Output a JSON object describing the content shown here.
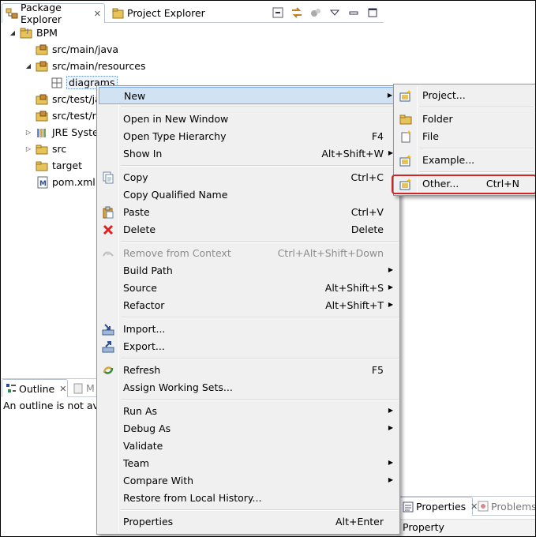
{
  "views": {
    "package_explorer_tab": "Package Explorer",
    "project_explorer_tab": "Project Explorer",
    "outline_tab": "Outline",
    "outline_second_tab": "M",
    "outline_message": "An outline is not ava",
    "properties_tab": "Properties",
    "problems_tab": "Problems",
    "properties_column": "Property"
  },
  "tree": [
    {
      "label": "BPM",
      "icon": "project-icon"
    },
    {
      "label": "src/main/java",
      "icon": "package-folder-icon"
    },
    {
      "label": "src/main/resources",
      "icon": "package-folder-icon"
    },
    {
      "label": "diagrams",
      "icon": "package-icon"
    },
    {
      "label": "src/test/ja",
      "icon": "package-folder-icon"
    },
    {
      "label": "src/test/r",
      "icon": "package-folder-icon"
    },
    {
      "label": "JRE Syste",
      "icon": "library-icon"
    },
    {
      "label": "src",
      "icon": "folder-icon"
    },
    {
      "label": "target",
      "icon": "folder-icon"
    },
    {
      "label": "pom.xml",
      "icon": "maven-file-icon"
    }
  ],
  "context_menu": {
    "new": "New",
    "open_new_window": "Open in New Window",
    "open_type_hierarchy": "Open Type Hierarchy",
    "open_type_hierarchy_sc": "F4",
    "show_in": "Show In",
    "show_in_sc": "Alt+Shift+W",
    "copy": "Copy",
    "copy_sc": "Ctrl+C",
    "copy_qualified": "Copy Qualified Name",
    "paste": "Paste",
    "paste_sc": "Ctrl+V",
    "delete": "Delete",
    "delete_sc": "Delete",
    "remove_context": "Remove from Context",
    "remove_context_sc": "Ctrl+Alt+Shift+Down",
    "build_path": "Build Path",
    "source": "Source",
    "source_sc": "Alt+Shift+S",
    "refactor": "Refactor",
    "refactor_sc": "Alt+Shift+T",
    "import": "Import...",
    "export": "Export...",
    "refresh": "Refresh",
    "refresh_sc": "F5",
    "assign_working_sets": "Assign Working Sets...",
    "run_as": "Run As",
    "debug_as": "Debug As",
    "validate": "Validate",
    "team": "Team",
    "compare_with": "Compare With",
    "restore_history": "Restore from Local History...",
    "properties": "Properties",
    "properties_sc": "Alt+Enter"
  },
  "new_submenu": {
    "project": "Project...",
    "folder": "Folder",
    "file": "File",
    "example": "Example...",
    "other": "Other...",
    "other_sc": "Ctrl+N"
  },
  "colors": {
    "highlight": "#d1e2f2",
    "highlight_border": "#78aee5",
    "annotation_red": "#d12424"
  }
}
